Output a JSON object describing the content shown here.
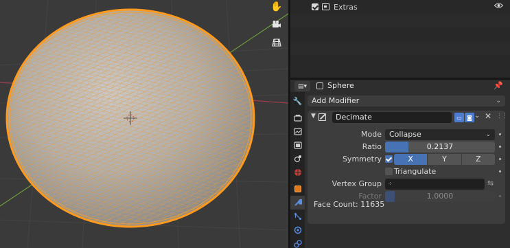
{
  "outliner": {
    "rows": [
      {
        "label": "Extras",
        "checked": true,
        "icon": "collection-icon"
      }
    ]
  },
  "viewport": {
    "tools": [
      "hand-pan-icon",
      "camera-view-icon",
      "grid-ortho-icon"
    ]
  },
  "properties": {
    "object_name": "Sphere",
    "add_modifier_label": "Add Modifier",
    "tabs": [
      "tool-icon",
      "render-icon",
      "output-icon",
      "view-layer-icon",
      "scene-icon",
      "world-icon",
      "object-icon",
      "modifier-wrench-icon",
      "particles-icon",
      "physics-icon",
      "constraints-icon"
    ],
    "modifier": {
      "name": "Decimate",
      "mode_label": "Mode",
      "mode_value": "Collapse",
      "ratio_label": "Ratio",
      "ratio_value": "0.2137",
      "ratio_fraction": 0.2137,
      "symmetry_label": "Symmetry",
      "symmetry_checked": true,
      "symmetry_axes": [
        "X",
        "Y",
        "Z"
      ],
      "symmetry_active_axis": "X",
      "triangulate_label": "Triangulate",
      "triangulate_checked": false,
      "vertex_group_label": "Vertex Group",
      "vertex_group_value": "",
      "factor_label": "Factor",
      "factor_value": "1.0000",
      "face_count": "Face Count: 11635"
    }
  },
  "colors": {
    "accent": "#4772b3",
    "wireframe": "#f0a030",
    "viewport_bg": "#3a3a3a"
  }
}
